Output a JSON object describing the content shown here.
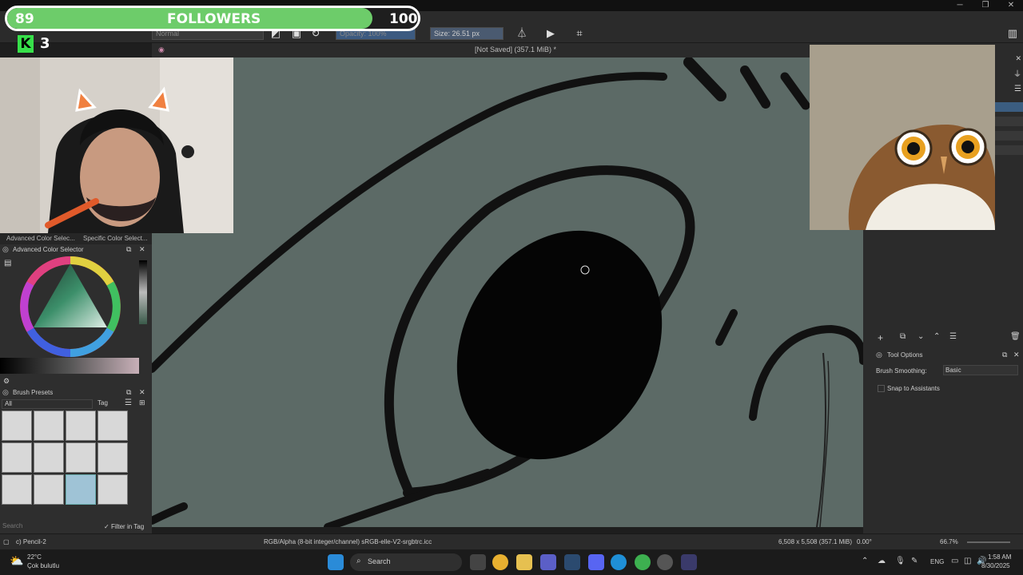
{
  "overlay": {
    "followers_current": "89",
    "followers_label": "FOLLOWERS",
    "followers_goal": "100",
    "followers_progress": 0.89,
    "kick_count": "3",
    "kick_letter": "K"
  },
  "toolbar": {
    "blend_mode": "Normal",
    "opacity": "Opacity: 100%",
    "size": "Size: 26.51 px"
  },
  "document": {
    "title": "[Not Saved]  (357.1 MiB) *"
  },
  "left_dock": {
    "tab_advanced": "Advanced Color Selec...",
    "tab_specific": "Specific Color Select...",
    "color_selector_title": "Advanced Color Selector",
    "brush_presets_title": "Brush Presets",
    "filter_all": "All",
    "tag_label": "Tag",
    "search_placeholder": "Search",
    "filter_in_tag": "Filter in Tag"
  },
  "right_dock": {
    "tool_options_title": "Tool Options",
    "brush_smoothing_label": "Brush Smoothing:",
    "brush_smoothing_value": "Basic",
    "snap_to_assistants": "Snap to Assistants"
  },
  "statusbar": {
    "brush_name": "c) Pencil-2",
    "color_space": "RGB/Alpha (8-bit integer/channel)  sRGB-elle-V2-srgbtrc.icc",
    "dimensions": "6,508 x 5,508 (357.1 MiB)",
    "rotation": "0.00°",
    "zoom": "66.7%"
  },
  "taskbar": {
    "weather_temp": "22°C",
    "weather_desc": "Çok bulutlu",
    "search_label": "Search",
    "language": "ENG",
    "time": "1:58 AM",
    "date": "8/30/2025"
  },
  "colors": {
    "canvas_bg": "#5c6a66",
    "follower_fill": "#6dcc6a",
    "kick_green": "#37e04a"
  }
}
